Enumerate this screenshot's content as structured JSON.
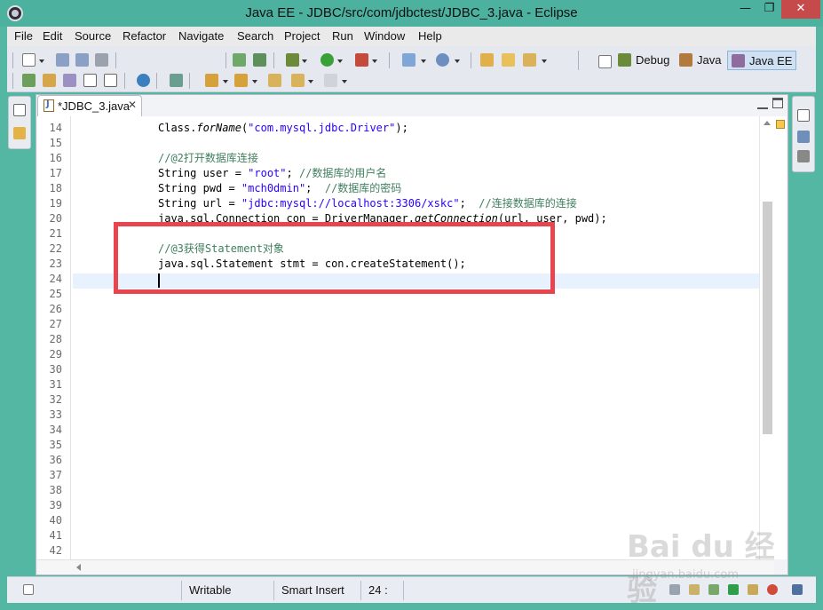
{
  "window": {
    "title": "Java EE - JDBC/src/com/jdbctest/JDBC_3.java - Eclipse",
    "minimize": "—",
    "maximize": "❐",
    "close": "✕"
  },
  "menu": [
    "File",
    "Edit",
    "Source",
    "Refactor",
    "Navigate",
    "Search",
    "Project",
    "Run",
    "Window",
    "Help"
  ],
  "perspectives": {
    "debug": "Debug",
    "java": "Java",
    "javaee": "Java EE",
    "active": "Java EE"
  },
  "editor": {
    "tab_label": "*JDBC_3.java",
    "line_numbers": [
      "14",
      "15",
      "16",
      "17",
      "18",
      "19",
      "20",
      "21",
      "22",
      "23",
      "24",
      "25",
      "26",
      "27",
      "28",
      "29",
      "30",
      "31",
      "32",
      "33",
      "34",
      "35",
      "36",
      "37",
      "38",
      "39",
      "40",
      "41",
      "42"
    ],
    "code": {
      "l14": {
        "a": "Class.",
        "b": "forName",
        "c": "(",
        "d": "\"com.mysql.jdbc.Driver\"",
        "e": ");"
      },
      "l16": {
        "a": "//@2打开数据库连接"
      },
      "l17": {
        "a": "String user = ",
        "b": "\"root\"",
        "c": "; ",
        "d": "//数据库的用户名"
      },
      "l18": {
        "a": "String pwd = ",
        "b": "\"mch0dmin\"",
        "c": ";  ",
        "d": "//数据库的密码"
      },
      "l19": {
        "a": "String url = ",
        "b": "\"jdbc:mysql://localhost:3306/xskc\"",
        "c": ";  ",
        "d": "//连接数据库的连接"
      },
      "l20": {
        "a": "java.sql.Connection con = DriverManager.",
        "b": "getConnection",
        "c": "(url, user, pwd);"
      },
      "l22": {
        "a": "//@3获得Statement对象"
      },
      "l23": {
        "a": "java.sql.Statement stmt = con.createStatement();"
      }
    },
    "current_line": "24"
  },
  "status": {
    "writable": "Writable",
    "insert_mode": "Smart Insert",
    "position": "24 :"
  },
  "watermark": {
    "brand": "Bai du 经验",
    "sub": "jingyan.baidu.com"
  },
  "colors": {
    "titlebar": "#4db1a0",
    "highlight_box": "#e8454e",
    "comment": "#3f7f5f",
    "string": "#2a00ff",
    "current_line": "#e8f2fe"
  }
}
